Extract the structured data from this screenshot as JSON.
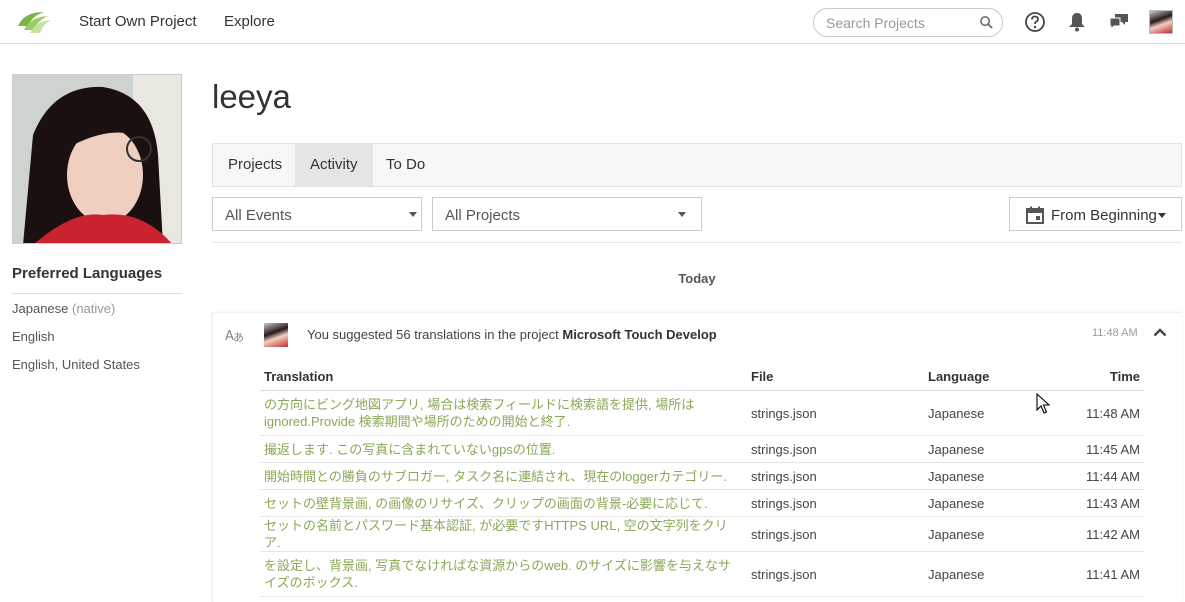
{
  "nav": {
    "start_project": "Start Own Project",
    "explore": "Explore",
    "search_placeholder": "Search Projects"
  },
  "profile": {
    "username": "leeya",
    "preferred_heading": "Preferred Languages",
    "languages": [
      {
        "name": "Japanese",
        "note": "(native)"
      },
      {
        "name": "English",
        "note": ""
      },
      {
        "name": "English, United States",
        "note": ""
      }
    ]
  },
  "tabs": [
    {
      "label": "Projects",
      "active": false
    },
    {
      "label": "Activity",
      "active": true
    },
    {
      "label": "To Do",
      "active": false
    }
  ],
  "filters": {
    "events": "All Events",
    "projects": "All Projects",
    "date": "From Beginning"
  },
  "feed": {
    "day": "Today",
    "entry": {
      "text_before": "You suggested 56 translations in the project ",
      "project": "Microsoft Touch Develop",
      "time": "11:48 AM"
    },
    "table": {
      "headers": {
        "translation": "Translation",
        "file": "File",
        "language": "Language",
        "time": "Time"
      },
      "rows": [
        {
          "translation": "の方向にビング地図アプリ, 場合は検索フィールドに検索語を提供, 場所は ignored.Provide 検索期間や場所のための開始と終了.",
          "file": "strings.json",
          "language": "Japanese",
          "time": "11:48 AM"
        },
        {
          "translation": "撮返します. この写真に含まれていないgpsの位置.",
          "file": "strings.json",
          "language": "Japanese",
          "time": "11:45 AM"
        },
        {
          "translation": "開始時間との勝負のサブロガー, タスク名に連結され、現在のloggerカテゴリー.",
          "file": "strings.json",
          "language": "Japanese",
          "time": "11:44 AM"
        },
        {
          "translation": "セットの壁背景画, の画像のリサイズ、クリップの画面の背景-必要に応じて.",
          "file": "strings.json",
          "language": "Japanese",
          "time": "11:43 AM"
        },
        {
          "translation": "セットの名前とパスワード基本認証, が必要ですHTTPS URL, 空の文字列をクリア.",
          "file": "strings.json",
          "language": "Japanese",
          "time": "11:42 AM"
        },
        {
          "translation": "を設定し、背景画, 写真でなければな資源からのweb. のサイズに影響を与えなサイズのボックス.",
          "file": "strings.json",
          "language": "Japanese",
          "time": "11:41 AM"
        }
      ]
    }
  },
  "colors": {
    "accent_green": "#8aa857",
    "logo_green": "#7cb342"
  }
}
